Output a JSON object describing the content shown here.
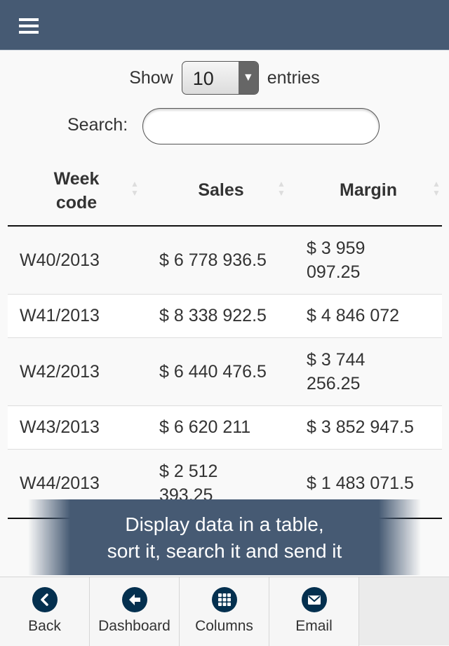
{
  "header": {
    "menu_icon": "hamburger-menu-icon"
  },
  "length": {
    "prefix": "Show",
    "selected": "10",
    "suffix": "entries"
  },
  "search": {
    "label": "Search:",
    "value": "",
    "placeholder": ""
  },
  "table": {
    "columns": [
      "Week code",
      "Sales",
      "Margin"
    ],
    "rows": [
      [
        "W40/2013",
        "$ 6 778 936.5",
        "$ 3 959 097.25"
      ],
      [
        "W41/2013",
        "$ 8 338 922.5",
        "$ 4 846 072"
      ],
      [
        "W42/2013",
        "$ 6 440 476.5",
        "$ 3 744 256.25"
      ],
      [
        "W43/2013",
        "$ 6 620 211",
        "$ 3 852 947.5"
      ],
      [
        "W44/2013",
        "$ 2 512 393.25",
        "$ 1 483 071.5"
      ]
    ]
  },
  "banner": {
    "line1": "Display data in a table,",
    "line2": "sort it, search it and send it"
  },
  "toolbar": [
    {
      "label": "Back",
      "icon": "back-chevron-icon"
    },
    {
      "label": "Dashboard",
      "icon": "arrow-left-icon"
    },
    {
      "label": "Columns",
      "icon": "grid-icon"
    },
    {
      "label": "Email",
      "icon": "envelope-icon"
    }
  ],
  "colors": {
    "header": "#465a73",
    "icon": "#04304f"
  }
}
